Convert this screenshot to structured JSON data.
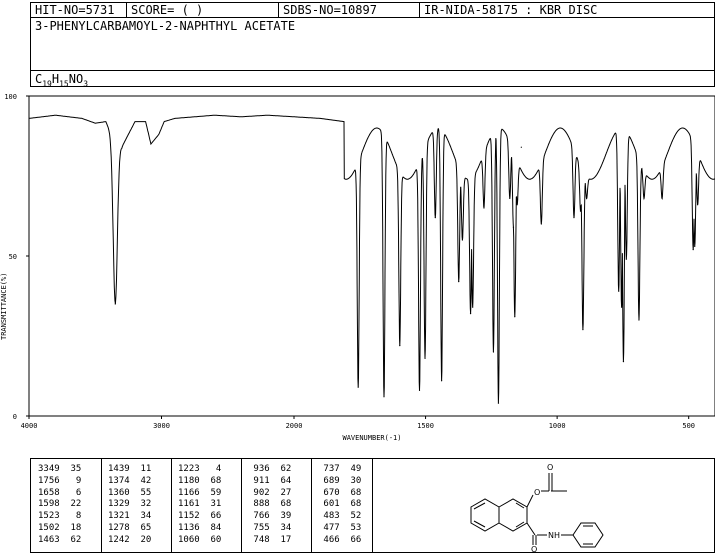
{
  "header": {
    "hit_no": "HIT-NO=5731",
    "score": "SCORE=  (   )",
    "sdbs_no": "SDBS-NO=10897",
    "method": "IR-NIDA-58175 : KBR DISC",
    "compound": "3-PHENYLCARBAMOYL-2-NAPHTHYL ACETATE",
    "formula_parts": [
      "C",
      "19",
      "H",
      "15",
      "NO",
      "3"
    ]
  },
  "chart_data": {
    "type": "line",
    "xlabel": "WAVENUMBER(-1)",
    "ylabel": "TRANSMITTANCE(%)",
    "xlim": [
      4000,
      400
    ],
    "ylim": [
      0,
      100
    ],
    "x_ticks": [
      4000,
      3000,
      2000,
      1500,
      1000,
      500
    ],
    "y_ticks": [
      0,
      50,
      100
    ],
    "grid": false,
    "baseline_points": [
      [
        4000,
        93
      ],
      [
        3800,
        94
      ],
      [
        3600,
        93
      ],
      [
        3500,
        91.5
      ],
      [
        3420,
        92
      ],
      [
        3380,
        88
      ],
      [
        3300,
        84
      ],
      [
        3250,
        88
      ],
      [
        3200,
        92
      ],
      [
        3120,
        92
      ],
      [
        3080,
        85
      ],
      [
        3020,
        88
      ],
      [
        2980,
        92
      ],
      [
        2900,
        93
      ],
      [
        2600,
        94
      ],
      [
        2400,
        93.5
      ],
      [
        2200,
        94
      ],
      [
        2000,
        93.5
      ],
      [
        1900,
        93
      ],
      [
        1810,
        92
      ]
    ],
    "peaks": [
      {
        "wavenumber": 3349,
        "transmittance": 35
      },
      {
        "wavenumber": 1756,
        "transmittance": 9
      },
      {
        "wavenumber": 1658,
        "transmittance": 6
      },
      {
        "wavenumber": 1598,
        "transmittance": 22
      },
      {
        "wavenumber": 1523,
        "transmittance": 8
      },
      {
        "wavenumber": 1502,
        "transmittance": 18
      },
      {
        "wavenumber": 1463,
        "transmittance": 62
      },
      {
        "wavenumber": 1439,
        "transmittance": 11
      },
      {
        "wavenumber": 1374,
        "transmittance": 42
      },
      {
        "wavenumber": 1360,
        "transmittance": 55
      },
      {
        "wavenumber": 1329,
        "transmittance": 32
      },
      {
        "wavenumber": 1321,
        "transmittance": 34
      },
      {
        "wavenumber": 1278,
        "transmittance": 65
      },
      {
        "wavenumber": 1242,
        "transmittance": 20
      },
      {
        "wavenumber": 1223,
        "transmittance": 4
      },
      {
        "wavenumber": 1180,
        "transmittance": 68
      },
      {
        "wavenumber": 1166,
        "transmittance": 59
      },
      {
        "wavenumber": 1161,
        "transmittance": 31
      },
      {
        "wavenumber": 1152,
        "transmittance": 66
      },
      {
        "wavenumber": 1136,
        "transmittance": 84
      },
      {
        "wavenumber": 1060,
        "transmittance": 60
      },
      {
        "wavenumber": 936,
        "transmittance": 62
      },
      {
        "wavenumber": 911,
        "transmittance": 64
      },
      {
        "wavenumber": 902,
        "transmittance": 27
      },
      {
        "wavenumber": 888,
        "transmittance": 68
      },
      {
        "wavenumber": 766,
        "transmittance": 39
      },
      {
        "wavenumber": 755,
        "transmittance": 34
      },
      {
        "wavenumber": 748,
        "transmittance": 17
      },
      {
        "wavenumber": 737,
        "transmittance": 49
      },
      {
        "wavenumber": 689,
        "transmittance": 30
      },
      {
        "wavenumber": 670,
        "transmittance": 68
      },
      {
        "wavenumber": 601,
        "transmittance": 68
      },
      {
        "wavenumber": 483,
        "transmittance": 52
      },
      {
        "wavenumber": 477,
        "transmittance": 53
      },
      {
        "wavenumber": 466,
        "transmittance": 66
      }
    ]
  },
  "peak_table_columns": [
    [
      "3349  35",
      "1756   9",
      "1658   6",
      "1598  22",
      "1523   8",
      "1502  18",
      "1463  62"
    ],
    [
      "1439  11",
      "1374  42",
      "1360  55",
      "1329  32",
      "1321  34",
      "1278  65",
      "1242  20"
    ],
    [
      "1223   4",
      "1180  68",
      "1166  59",
      "1161  31",
      "1152  66",
      "1136  84",
      "1060  60"
    ],
    [
      " 936  62",
      " 911  64",
      " 902  27",
      " 888  68",
      " 766  39",
      " 755  34",
      " 748  17"
    ],
    [
      " 737  49",
      " 689  30",
      " 670  68",
      " 601  68",
      " 483  52",
      " 477  53",
      " 466  66"
    ]
  ],
  "structure": {
    "ester_oxygen": "O",
    "carbonyl_oxygen_top": "O",
    "carbonyl_oxygen_bottom": "O",
    "amide": "NH"
  }
}
